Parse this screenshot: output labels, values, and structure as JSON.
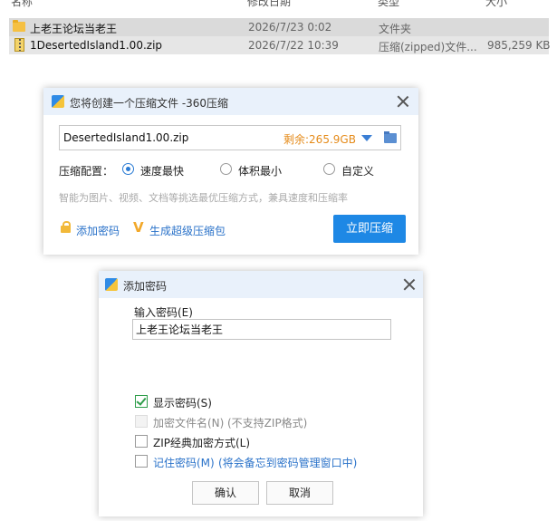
{
  "explorer": {
    "columns": {
      "name": "名称",
      "date": "修改日期",
      "type": "类型",
      "size": "大小"
    },
    "rows": [
      {
        "name": "上老王论坛当老王",
        "date": "2026/7/23 0:02",
        "type": "文件夹",
        "size": "",
        "icon": "folder-icon"
      },
      {
        "name": "1DesertedIsland1.00.zip",
        "date": "2026/7/22 10:39",
        "type": "压缩(zipped)文件...",
        "size": "985,259 KB",
        "icon": "zip-file-icon"
      }
    ]
  },
  "compress_dialog": {
    "title": "您将创建一个压缩文件 -360压缩",
    "filename": "DesertedIsland1.00.zip",
    "remaining": "剩余:265.9GB",
    "config_label": "压缩配置：",
    "options": [
      "速度最快",
      "体积最小",
      "自定义"
    ],
    "selected_option": "速度最快",
    "hint": "智能为图片、视频、文档等挑选最优压缩方式，兼具速度和压缩率",
    "add_password": "添加密码",
    "super_compress": "生成超级压缩包",
    "compress_now": "立即压缩",
    "colors": {
      "accent": "#1e88e5",
      "remaining": "#e58b1a",
      "title_bar": "#e9f1fb"
    }
  },
  "password_dialog": {
    "title": "添加密码",
    "input_label": "输入密码(E)",
    "password_value": "上老王论坛当老王",
    "show_password": "显示密码(S)",
    "encrypt_filenames": "加密文件名(N)",
    "encrypt_filenames_note": "(不支持ZIP格式)",
    "zip_classic": "ZIP经典加密方式(L)",
    "remember_password": "记住密码(M)",
    "remember_note": "(将会备忘到密码管理窗口中)",
    "ok": "确认",
    "cancel": "取消",
    "checks": {
      "show_password": true,
      "encrypt_filenames": false,
      "zip_classic": false,
      "remember_password": false
    }
  }
}
